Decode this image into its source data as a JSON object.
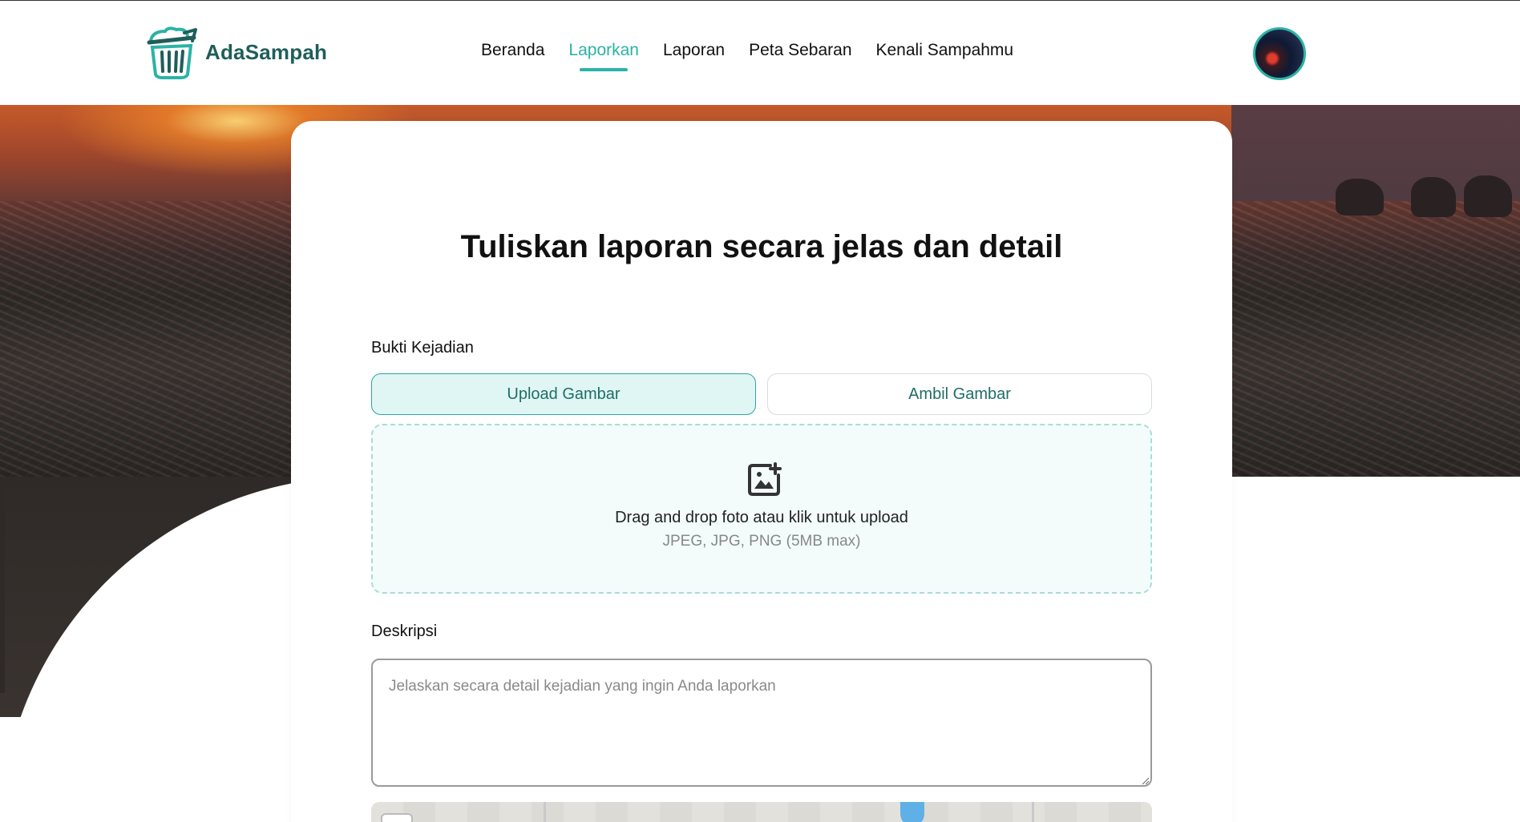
{
  "header": {
    "brand": "AdaSampah",
    "nav": [
      {
        "label": "Beranda",
        "active": false
      },
      {
        "label": "Laporkan",
        "active": true
      },
      {
        "label": "Laporan",
        "active": false
      },
      {
        "label": "Peta Sebaran",
        "active": false
      },
      {
        "label": "Kenali Sampahmu",
        "active": false
      }
    ],
    "avatar_icon": "user-avatar"
  },
  "form": {
    "title": "Tuliskan laporan secara jelas dan detail",
    "evidence_label": "Bukti Kejadian",
    "upload_button": "Upload Gambar",
    "camera_button": "Ambil Gambar",
    "dropzone": {
      "icon": "add-photo-icon",
      "main_text": "Drag and drop foto atau klik untuk upload",
      "sub_text": "JPEG, JPG, PNG (5MB max)"
    },
    "description_label": "Deskripsi",
    "description_placeholder": "Jelaskan secara detail kejadian yang ingin Anda laporkan",
    "description_value": ""
  },
  "colors": {
    "accent": "#2bb3a6",
    "brand_text": "#1f5e5a",
    "upload_bg": "#dff6f4",
    "dropzone_bg": "#f3fcfb"
  }
}
